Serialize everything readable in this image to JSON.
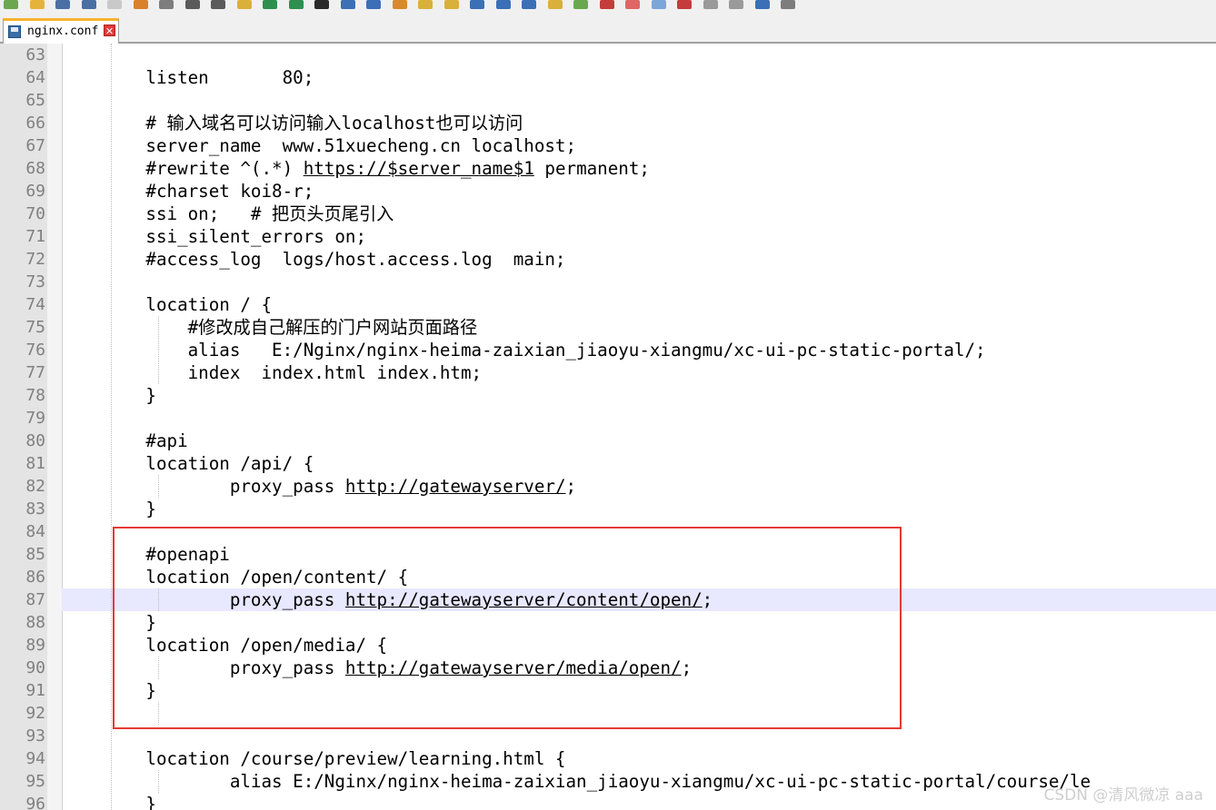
{
  "tab": {
    "title": "nginx.conf",
    "close": "✕"
  },
  "toolbar": {
    "icons": [
      "new-file-icon",
      "open-file-icon",
      "save-icon",
      "save-all-icon",
      "close-icon",
      "close-all-icon",
      "print-icon",
      "cut-icon",
      "copy-icon",
      "paste-icon",
      "undo-icon",
      "redo-icon",
      "find-icon",
      "replace-icon",
      "zoom-in-icon",
      "zoom-out-icon",
      "sync-v-icon",
      "sync-h-icon",
      "word-wrap-icon",
      "all-chars-icon",
      "indent-guide-icon",
      "udl-icon",
      "doc-map-icon",
      "func-list-icon",
      "folder-workspace-icon",
      "monitor-icon",
      "record-macro-icon",
      "stop-macro-icon",
      "play-macro-icon",
      "run-macro-icon",
      "save-macro-icon"
    ]
  },
  "editor": {
    "current_line": 87,
    "lines": [
      {
        "no": "63",
        "text": ""
      },
      {
        "no": "64",
        "text": "        listen       80;"
      },
      {
        "no": "65",
        "text": ""
      },
      {
        "no": "66",
        "text": "        # 输入域名可以访问输入localhost也可以访问"
      },
      {
        "no": "67",
        "text": "        server_name  www.51xuecheng.cn localhost;"
      },
      {
        "no": "68",
        "pre": "        #rewrite ^(.*) ",
        "link": "https://$server_name$1",
        "post": " permanent;"
      },
      {
        "no": "69",
        "text": "        #charset koi8-r;"
      },
      {
        "no": "70",
        "text": "        ssi on;   # 把页头页尾引入"
      },
      {
        "no": "71",
        "text": "        ssi_silent_errors on;"
      },
      {
        "no": "72",
        "text": "        #access_log  logs/host.access.log  main;"
      },
      {
        "no": "73",
        "text": ""
      },
      {
        "no": "74",
        "text": "        location / {"
      },
      {
        "no": "75",
        "text": "            #修改成自己解压的门户网站页面路径"
      },
      {
        "no": "76",
        "text": "            alias   E:/Nginx/nginx-heima-zaixian_jiaoyu-xiangmu/xc-ui-pc-static-portal/;"
      },
      {
        "no": "77",
        "text": "            index  index.html index.htm;"
      },
      {
        "no": "78",
        "text": "        }"
      },
      {
        "no": "79",
        "text": ""
      },
      {
        "no": "80",
        "text": "        #api"
      },
      {
        "no": "81",
        "text": "        location /api/ {"
      },
      {
        "no": "82",
        "pre": "                proxy_pass ",
        "link": "http://gatewayserver/",
        "post": ";"
      },
      {
        "no": "83",
        "text": "        }"
      },
      {
        "no": "84",
        "text": ""
      },
      {
        "no": "85",
        "text": "        #openapi"
      },
      {
        "no": "86",
        "text": "        location /open/content/ {"
      },
      {
        "no": "87",
        "pre": "                proxy_pass ",
        "link": "http://gatewayserver/content/open/",
        "post": ";"
      },
      {
        "no": "88",
        "text": "        }"
      },
      {
        "no": "89",
        "text": "        location /open/media/ {"
      },
      {
        "no": "90",
        "pre": "                proxy_pass ",
        "link": "http://gatewayserver/media/open/",
        "post": ";"
      },
      {
        "no": "91",
        "text": "        }"
      },
      {
        "no": "92",
        "text": ""
      },
      {
        "no": "93",
        "text": ""
      },
      {
        "no": "94",
        "text": "        location /course/preview/learning.html {"
      },
      {
        "no": "95",
        "text": "                alias E:/Nginx/nginx-heima-zaixian_jiaoyu-xiangmu/xc-ui-pc-static-portal/course/le"
      },
      {
        "no": "96",
        "text": "        }"
      }
    ]
  },
  "watermark": "CSDN @清风微凉 aaa",
  "colors": {
    "highlight_box": "#e53935",
    "current_line": "#e8e8ff",
    "gutter": "#e4e4e4"
  }
}
